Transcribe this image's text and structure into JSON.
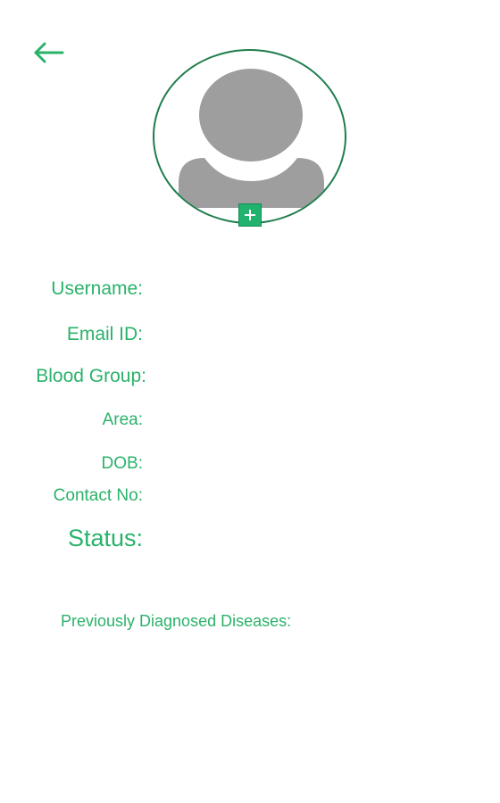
{
  "header": {
    "back_icon": "arrow-left-icon"
  },
  "profile": {
    "avatar_icon": "user-placeholder-icon",
    "add_photo_icon": "plus-icon"
  },
  "fields": {
    "username_label": "Username:",
    "email_label": "Email ID:",
    "blood_group_label": "Blood Group:",
    "area_label": "Area:",
    "dob_label": "DOB:",
    "contact_label": "Contact No:",
    "status_label": "Status:",
    "diseases_label": "Previously Diagnosed Diseases:"
  },
  "colors": {
    "accent": "#2ab26a",
    "circle_border": "#1f7d4d",
    "avatar_gray": "#9e9e9e"
  }
}
